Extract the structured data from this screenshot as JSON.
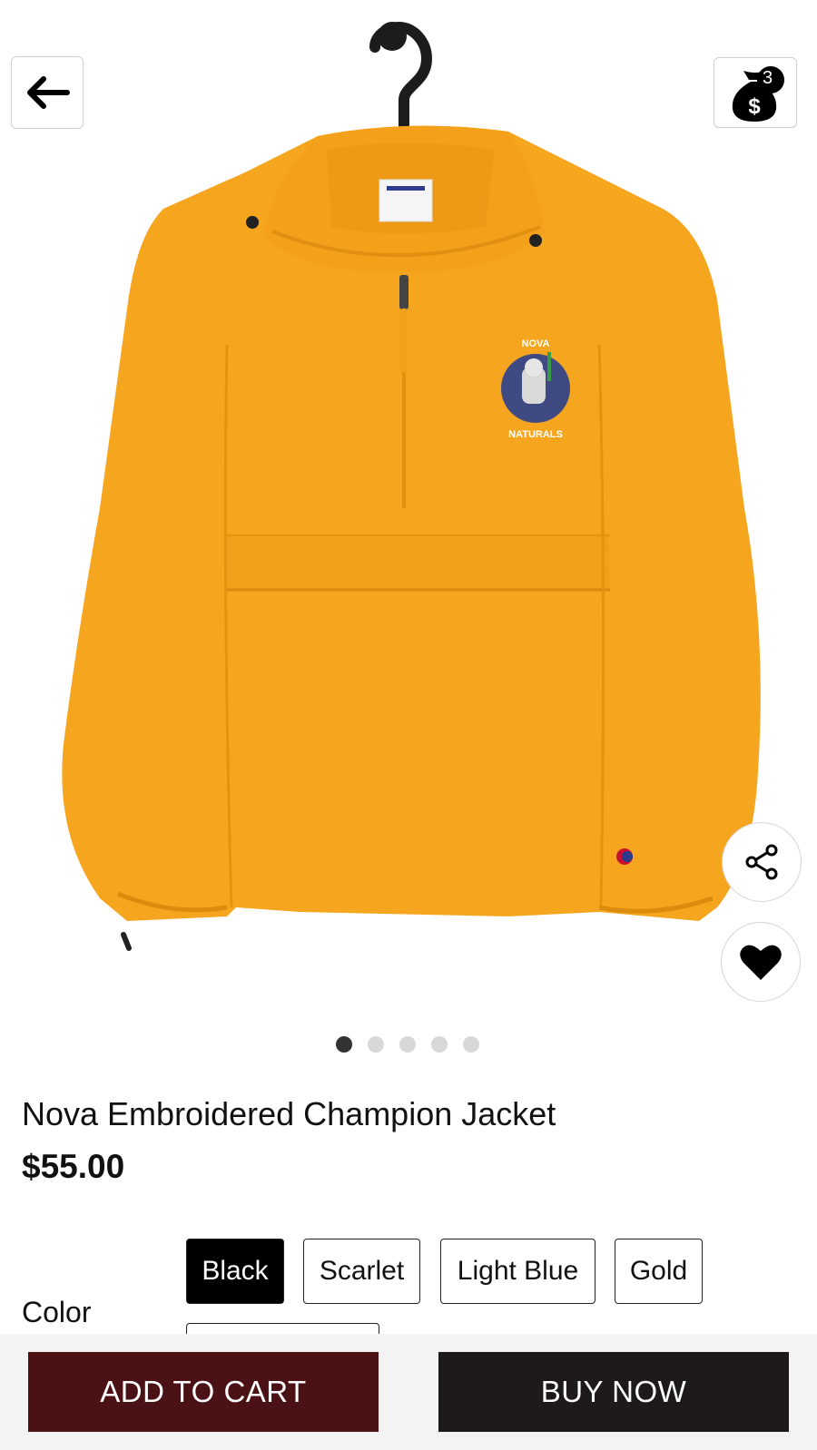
{
  "header": {
    "cart_count": "3"
  },
  "gallery": {
    "image_alt": "Gold hooded half-zip jacket on hanger",
    "embroidery_text_top": "NOVA",
    "embroidery_text_bottom": "NATURALS",
    "slide_count": 5,
    "active_slide": 0,
    "jacket_color": "#F6A51E"
  },
  "product": {
    "title": "Nova Embroidered Champion Jacket",
    "price": "$55.00"
  },
  "options": {
    "color_label": "Color",
    "colors": [
      "Black",
      "Scarlet",
      "Light Blue",
      "Gold"
    ],
    "selected": "Black"
  },
  "actions": {
    "add_to_cart": "ADD TO CART",
    "buy_now": "BUY NOW"
  },
  "colors": {
    "add_to_cart_bg": "#4A1214",
    "buy_now_bg": "#1E1A1B"
  }
}
